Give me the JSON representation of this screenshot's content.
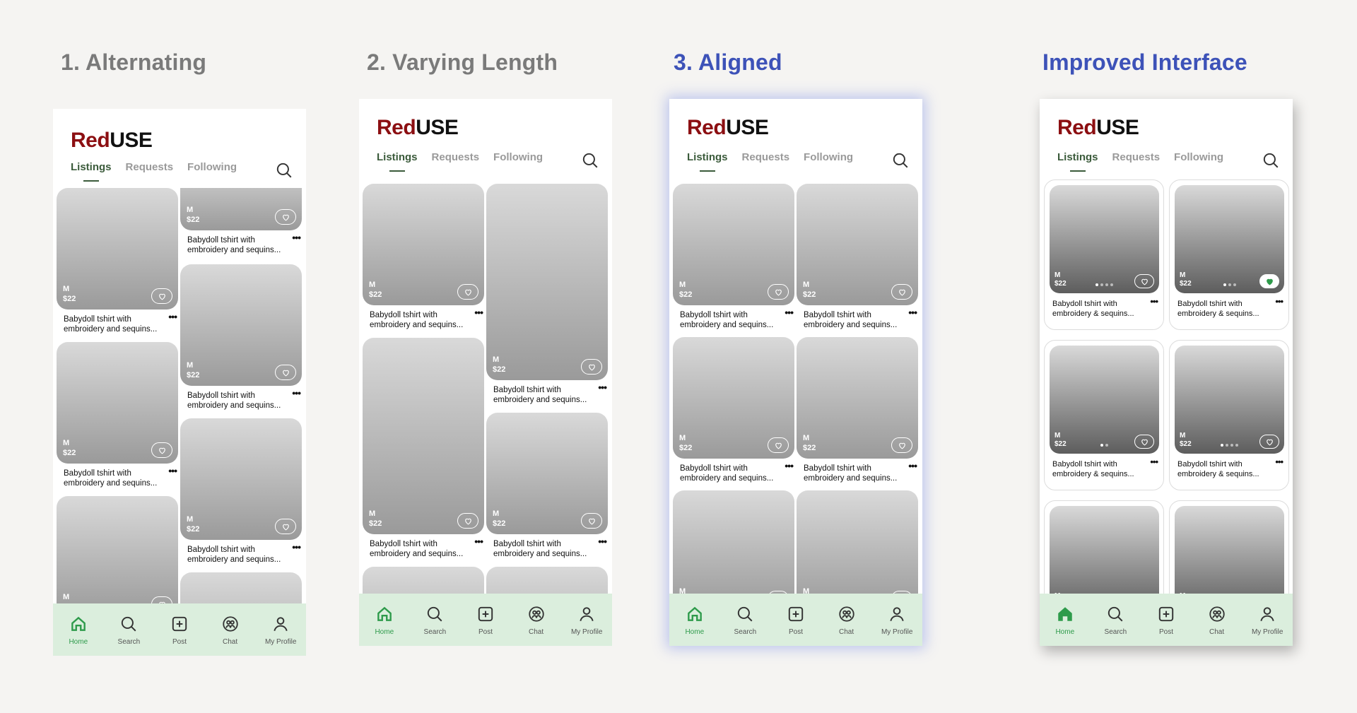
{
  "columns": [
    {
      "title": "1. Alternating"
    },
    {
      "title": "2. Varying Length"
    },
    {
      "title": "3. Aligned"
    },
    {
      "title": "Improved Interface"
    }
  ],
  "brand": {
    "part1": "Red",
    "part2": "USE"
  },
  "tabs": [
    "Listings",
    "Requests",
    "Following"
  ],
  "listing": {
    "size": "M",
    "price": "$22",
    "desc_line1": "Babydoll tshirt with",
    "desc_line2": "embroidery and sequins...",
    "desc_line2_improved": "embroidery & sequins...",
    "more": "•••"
  },
  "nav": [
    "Home",
    "Search",
    "Post",
    "Chat",
    "My Profile"
  ],
  "colors": {
    "accent_green": "#2e9b4b",
    "brand_red": "#8c0f12",
    "nav_bg": "#dbeedd",
    "title_blue": "#3d52b8"
  },
  "icons": [
    "search-icon",
    "heart-icon",
    "home-icon",
    "plus-square-icon",
    "chat-icon",
    "user-icon",
    "more-icon"
  ]
}
